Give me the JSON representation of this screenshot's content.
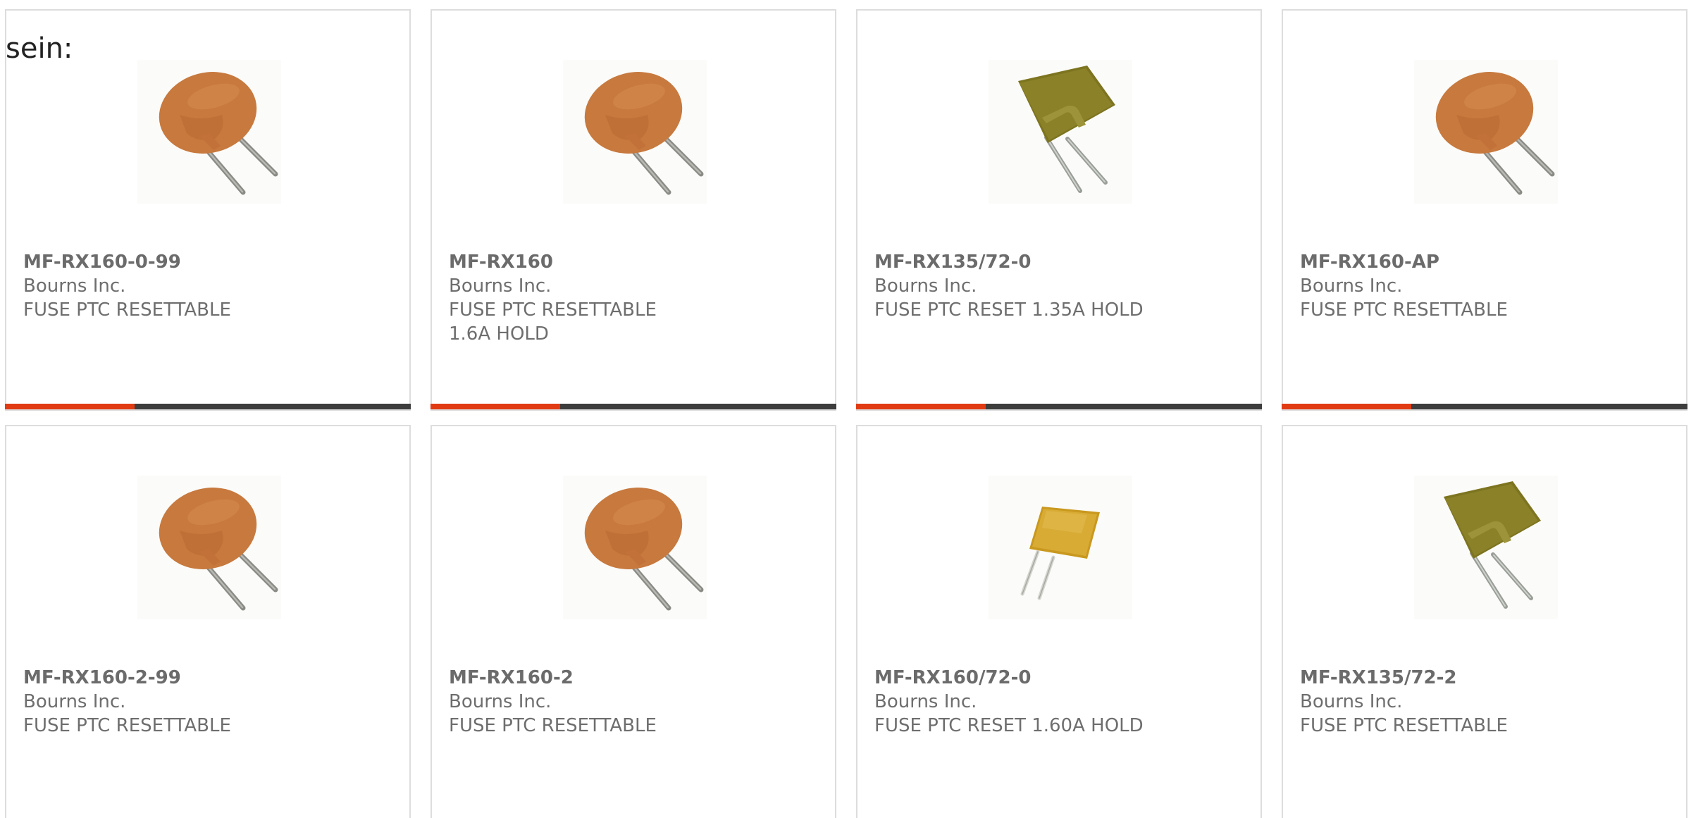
{
  "intro_text": "sein:",
  "colors": {
    "accent": "#e13b13",
    "bar": "#3d3d3d",
    "card_border": "#dddddd",
    "text": "#6e6e6e"
  },
  "products": [
    {
      "part_number": "MF-RX160-0-99",
      "manufacturer": "Bourns Inc.",
      "description": "FUSE PTC RESETTABLE",
      "image_icon": "radial-ptc-disc-icon"
    },
    {
      "part_number": "MF-RX160",
      "manufacturer": "Bourns Inc.",
      "description": "FUSE PTC RESETTABLE 1.6A HOLD",
      "image_icon": "radial-ptc-disc-icon"
    },
    {
      "part_number": "MF-RX135/72-0",
      "manufacturer": "Bourns Inc.",
      "description": "FUSE PTC RESET 1.35A HOLD",
      "image_icon": "radial-ptc-square-icon"
    },
    {
      "part_number": "MF-RX160-AP",
      "manufacturer": "Bourns Inc.",
      "description": "FUSE PTC RESETTABLE",
      "image_icon": "radial-ptc-disc-icon"
    },
    {
      "part_number": "MF-RX160-2-99",
      "manufacturer": "Bourns Inc.",
      "description": "FUSE PTC RESETTABLE",
      "image_icon": "radial-ptc-disc-icon"
    },
    {
      "part_number": "MF-RX160-2",
      "manufacturer": "Bourns Inc.",
      "description": "FUSE PTC RESETTABLE",
      "image_icon": "radial-ptc-disc-icon"
    },
    {
      "part_number": "MF-RX160/72-0",
      "manufacturer": "Bourns Inc.",
      "description": "FUSE PTC RESET 1.60A HOLD",
      "image_icon": "radial-ptc-small-square-icon"
    },
    {
      "part_number": "MF-RX135/72-2",
      "manufacturer": "Bourns Inc.",
      "description": "FUSE PTC RESETTABLE",
      "image_icon": "radial-ptc-square-icon"
    }
  ]
}
